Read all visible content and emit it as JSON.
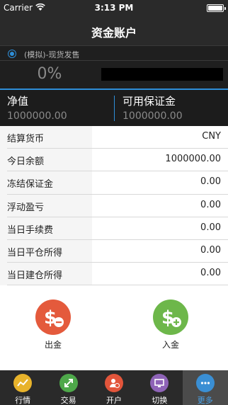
{
  "status_bar": {
    "carrier": "Carrier",
    "time": "3:13 PM"
  },
  "nav": {
    "title": "资金账户"
  },
  "account": {
    "name": "(模拟)-现货发售"
  },
  "summary": {
    "percent": "0%",
    "equity_label": "净值",
    "equity_value": "1000000.00",
    "available_margin_label": "可用保证金",
    "available_margin_value": "1000000.00"
  },
  "table": {
    "rows": [
      {
        "label": "结算货币",
        "value": "CNY"
      },
      {
        "label": "今日余额",
        "value": "1000000.00"
      },
      {
        "label": "冻结保证金",
        "value": "0.00"
      },
      {
        "label": "浮动盈亏",
        "value": "0.00"
      },
      {
        "label": "当日手续费",
        "value": "0.00"
      },
      {
        "label": "当日平仓所得",
        "value": "0.00"
      },
      {
        "label": "当日建仓所得",
        "value": "0.00"
      }
    ]
  },
  "actions": {
    "withdraw_label": "出金",
    "deposit_label": "入金"
  },
  "tabs": [
    {
      "label": "行情",
      "icon": "market-chart-icon",
      "color": "#e8b32b"
    },
    {
      "label": "交易",
      "icon": "trade-arrows-icon",
      "color": "#4ea84a"
    },
    {
      "label": "开户",
      "icon": "open-account-icon",
      "color": "#e2553b"
    },
    {
      "label": "切换",
      "icon": "switch-monitor-icon",
      "color": "#8e63b7"
    },
    {
      "label": "更多",
      "icon": "more-dots-icon",
      "color": "#3a8fd4"
    }
  ],
  "colors": {
    "accent_blue": "#2e8ed8",
    "withdraw_red": "#e45a3c",
    "deposit_green": "#6db74a",
    "dark_bg": "#2a2a2a"
  }
}
